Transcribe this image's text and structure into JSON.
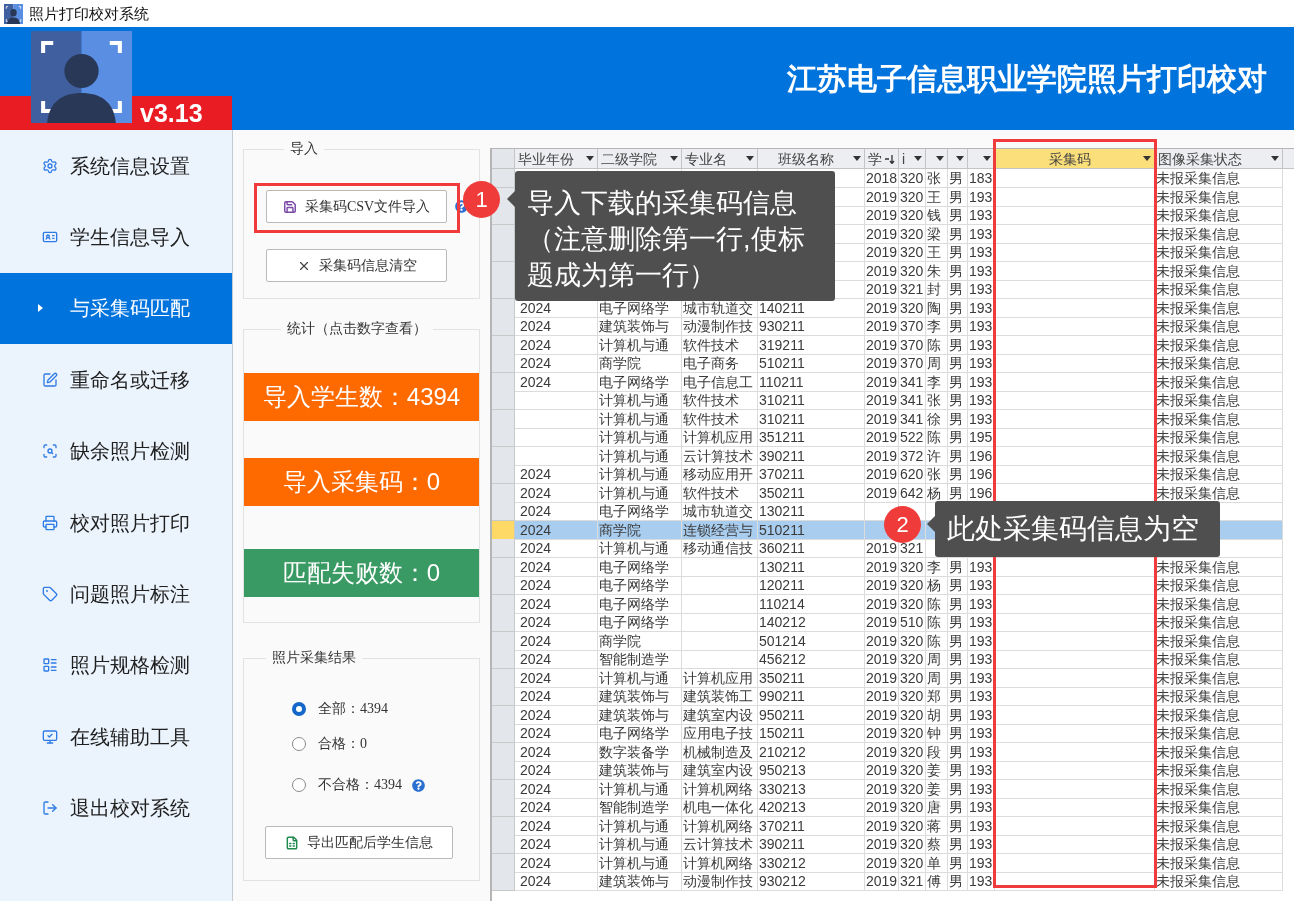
{
  "title_bar": {
    "title": "照片打印校对系统"
  },
  "header": {
    "version": "v3.13",
    "title": "江苏电子信息职业学院照片打印校对"
  },
  "sidebar": {
    "items": [
      {
        "label": "系统信息设置",
        "selected": false
      },
      {
        "label": "学生信息导入",
        "selected": false
      },
      {
        "label": "与采集码匹配",
        "selected": true
      },
      {
        "label": "重命名或迁移",
        "selected": false
      },
      {
        "label": "缺余照片检测",
        "selected": false
      },
      {
        "label": "校对照片打印",
        "selected": false
      },
      {
        "label": "问题照片标注",
        "selected": false
      },
      {
        "label": "照片规格检测",
        "selected": false
      },
      {
        "label": "在线辅助工具",
        "selected": false
      },
      {
        "label": "退出校对系统",
        "selected": false
      }
    ]
  },
  "import_group": {
    "legend": "导入",
    "buttons": [
      {
        "label": "采集码CSV文件导入",
        "help": true
      },
      {
        "label": "采集码信息清空",
        "help": false
      }
    ]
  },
  "stats_group": {
    "legend": "统计（点击数字查看）",
    "stats": [
      {
        "label": "导入学生数：4394",
        "color": "#ff6a00"
      },
      {
        "label": "导入采集码：0",
        "color": "#ff6a00"
      },
      {
        "label": "匹配失败数：0",
        "color": "#399a63"
      }
    ]
  },
  "result_group": {
    "legend": "照片采集结果",
    "options": [
      {
        "label": "全部：4394",
        "selected": true,
        "help": false
      },
      {
        "label": "合格：0",
        "selected": false,
        "help": false
      },
      {
        "label": "不合格：4394",
        "selected": false,
        "help": true
      }
    ],
    "export_button": "导出匹配后学生信息"
  },
  "table": {
    "columns": [
      {
        "label": "毕业年份",
        "selected": false,
        "sorted": false
      },
      {
        "label": "二级学院",
        "selected": false,
        "sorted": false
      },
      {
        "label": "专业名",
        "selected": false,
        "sorted": false
      },
      {
        "label": "班级名称",
        "selected": false,
        "sorted": false
      },
      {
        "label": "学",
        "selected": false,
        "sorted": true
      },
      {
        "label": "i",
        "selected": false,
        "sorted": false
      },
      {
        "selected": false,
        "sorted": false
      },
      {
        "selected": false,
        "sorted": false
      },
      {
        "selected": false,
        "sorted": false
      },
      {
        "label": "采集码",
        "selected": true,
        "sorted": false
      },
      {
        "label": "图像采集状态",
        "selected": false,
        "sorted": false
      }
    ],
    "rows": [
      {
        "selected": false,
        "column_5": "2018",
        "column_6": "320",
        "column_7": "张",
        "column_8": "男",
        "column_9": "183",
        "image_status": "未报采集信息"
      },
      {
        "selected": false,
        "column_5": "2019",
        "column_6": "320",
        "column_7": "王",
        "column_8": "男",
        "column_9": "193",
        "image_status": "未报采集信息"
      },
      {
        "selected": false,
        "column_5": "2019",
        "column_6": "320",
        "column_7": "钱",
        "column_8": "男",
        "column_9": "193",
        "image_status": "未报采集信息"
      },
      {
        "selected": false,
        "column_5": "2019",
        "column_6": "320",
        "column_7": "梁",
        "column_8": "男",
        "column_9": "193",
        "image_status": "未报采集信息"
      },
      {
        "selected": false,
        "column_5": "2019",
        "column_6": "320",
        "column_7": "王",
        "column_8": "男",
        "column_9": "193",
        "image_status": "未报采集信息"
      },
      {
        "selected": false,
        "column_5": "2019",
        "column_6": "320",
        "column_7": "朱",
        "column_8": "男",
        "column_9": "193",
        "image_status": "未报采集信息"
      },
      {
        "selected": false,
        "column_5": "2019",
        "column_6": "321",
        "column_7": "封",
        "column_8": "男",
        "column_9": "193",
        "image_status": "未报采集信息"
      },
      {
        "selected": false,
        "graduation_year": "2024",
        "college": "电子网络学",
        "column_3": "城市轨道交",
        "class_name": "140211",
        "column_5": "2019",
        "column_6": "320",
        "column_7": "陶",
        "column_8": "男",
        "column_9": "193",
        "image_status": "未报采集信息"
      },
      {
        "selected": false,
        "graduation_year": "2024",
        "college": "建筑装饰与",
        "column_3": "动漫制作技",
        "class_name": "930211",
        "column_5": "2019",
        "column_6": "370",
        "column_7": "李",
        "column_8": "男",
        "column_9": "193",
        "image_status": "未报采集信息"
      },
      {
        "selected": false,
        "graduation_year": "2024",
        "college": "计算机与通",
        "column_3": "软件技术",
        "class_name": "319211",
        "column_5": "2019",
        "column_6": "370",
        "column_7": "陈",
        "column_8": "男",
        "column_9": "193",
        "image_status": "未报采集信息"
      },
      {
        "selected": false,
        "graduation_year": "2024",
        "college": "商学院",
        "column_3": "电子商务",
        "class_name": "510211",
        "column_5": "2019",
        "column_6": "370",
        "column_7": "周",
        "column_8": "男",
        "column_9": "193",
        "image_status": "未报采集信息"
      },
      {
        "selected": false,
        "graduation_year": "2024",
        "college": "电子网络学",
        "column_3": "电子信息工",
        "class_name": "110211",
        "column_5": "2019",
        "column_6": "341",
        "column_7": "李",
        "column_8": "男",
        "column_9": "193",
        "image_status": "未报采集信息"
      },
      {
        "selected": false,
        "college": "计算机与通",
        "column_3": "软件技术",
        "class_name": "310211",
        "column_5": "2019",
        "column_6": "341",
        "column_7": "张",
        "column_8": "男",
        "column_9": "193",
        "image_status": "未报采集信息"
      },
      {
        "selected": false,
        "college": "计算机与通",
        "column_3": "软件技术",
        "class_name": "310211",
        "column_5": "2019",
        "column_6": "341",
        "column_7": "徐",
        "column_8": "男",
        "column_9": "193",
        "image_status": "未报采集信息"
      },
      {
        "selected": false,
        "college": "计算机与通",
        "column_3": "计算机应用",
        "class_name": "351211",
        "column_5": "2019",
        "column_6": "522",
        "column_7": "陈",
        "column_8": "男",
        "column_9": "195",
        "image_status": "未报采集信息"
      },
      {
        "selected": false,
        "college": "计算机与通",
        "column_3": "云计算技术",
        "class_name": "390211",
        "column_5": "2019",
        "column_6": "372",
        "column_7": "许",
        "column_8": "男",
        "column_9": "196",
        "image_status": "未报采集信息"
      },
      {
        "selected": false,
        "graduation_year": "2024",
        "college": "计算机与通",
        "column_3": "移动应用开",
        "class_name": "370211",
        "column_5": "2019",
        "column_6": "620",
        "column_7": "张",
        "column_8": "男",
        "column_9": "196",
        "image_status": "未报采集信息"
      },
      {
        "selected": false,
        "graduation_year": "2024",
        "college": "计算机与通",
        "column_3": "软件技术",
        "class_name": "350211",
        "column_5": "2019",
        "column_6": "642",
        "column_7": "杨",
        "column_8": "男",
        "column_9": "196",
        "image_status": "未报采集信息"
      },
      {
        "selected": false,
        "graduation_year": "2024",
        "college": "电子网络学",
        "column_3": "城市轨道交",
        "class_name": "130211"
      },
      {
        "selected": true,
        "graduation_year": "2024",
        "college": "商学院",
        "column_3": "连锁经营与",
        "class_name": "510211"
      },
      {
        "selected": false,
        "graduation_year": "2024",
        "college": "计算机与通",
        "column_3": "移动通信技",
        "class_name": "360211",
        "column_5": "2019",
        "column_6": "321"
      },
      {
        "selected": false,
        "graduation_year": "2024",
        "college": "电子网络学",
        "class_name": "130211",
        "column_5": "2019",
        "column_6": "320",
        "column_7": "李",
        "column_8": "男",
        "column_9": "193",
        "image_status": "未报采集信息"
      },
      {
        "selected": false,
        "graduation_year": "2024",
        "college": "电子网络学",
        "class_name": "120211",
        "column_5": "2019",
        "column_6": "320",
        "column_7": "杨",
        "column_8": "男",
        "column_9": "193",
        "image_status": "未报采集信息"
      },
      {
        "selected": false,
        "graduation_year": "2024",
        "college": "电子网络学",
        "class_name": "110214",
        "column_5": "2019",
        "column_6": "320",
        "column_7": "陈",
        "column_8": "男",
        "column_9": "193",
        "image_status": "未报采集信息"
      },
      {
        "selected": false,
        "graduation_year": "2024",
        "college": "电子网络学",
        "class_name": "140212",
        "column_5": "2019",
        "column_6": "510",
        "column_7": "陈",
        "column_8": "男",
        "column_9": "193",
        "image_status": "未报采集信息"
      },
      {
        "selected": false,
        "graduation_year": "2024",
        "college": "商学院",
        "class_name": "501214",
        "column_5": "2019",
        "column_6": "320",
        "column_7": "陈",
        "column_8": "男",
        "column_9": "193",
        "image_status": "未报采集信息"
      },
      {
        "selected": false,
        "graduation_year": "2024",
        "college": "智能制造学",
        "class_name": "456212",
        "column_5": "2019",
        "column_6": "320",
        "column_7": "周",
        "column_8": "男",
        "column_9": "193",
        "image_status": "未报采集信息"
      },
      {
        "selected": false,
        "graduation_year": "2024",
        "college": "计算机与通",
        "column_3": "计算机应用",
        "class_name": "350211",
        "column_5": "2019",
        "column_6": "320",
        "column_7": "周",
        "column_8": "男",
        "column_9": "193",
        "image_status": "未报采集信息"
      },
      {
        "selected": false,
        "graduation_year": "2024",
        "college": "建筑装饰与",
        "column_3": "建筑装饰工",
        "class_name": "990211",
        "column_5": "2019",
        "column_6": "320",
        "column_7": "郑",
        "column_8": "男",
        "column_9": "193",
        "image_status": "未报采集信息"
      },
      {
        "selected": false,
        "graduation_year": "2024",
        "college": "建筑装饰与",
        "column_3": "建筑室内设",
        "class_name": "950211",
        "column_5": "2019",
        "column_6": "320",
        "column_7": "胡",
        "column_8": "男",
        "column_9": "193",
        "image_status": "未报采集信息"
      },
      {
        "selected": false,
        "graduation_year": "2024",
        "college": "电子网络学",
        "column_3": "应用电子技",
        "class_name": "150211",
        "column_5": "2019",
        "column_6": "320",
        "column_7": "钟",
        "column_8": "男",
        "column_9": "193",
        "image_status": "未报采集信息"
      },
      {
        "selected": false,
        "graduation_year": "2024",
        "college": "数字装备学",
        "column_3": "机械制造及",
        "class_name": "210212",
        "column_5": "2019",
        "column_6": "320",
        "column_7": "段",
        "column_8": "男",
        "column_9": "193",
        "image_status": "未报采集信息"
      },
      {
        "selected": false,
        "graduation_year": "2024",
        "college": "建筑装饰与",
        "column_3": "建筑室内设",
        "class_name": "950213",
        "column_5": "2019",
        "column_6": "320",
        "column_7": "姜",
        "column_8": "男",
        "column_9": "193",
        "image_status": "未报采集信息"
      },
      {
        "selected": false,
        "graduation_year": "2024",
        "college": "计算机与通",
        "column_3": "计算机网络",
        "class_name": "330213",
        "column_5": "2019",
        "column_6": "320",
        "column_7": "姜",
        "column_8": "男",
        "column_9": "193",
        "image_status": "未报采集信息"
      },
      {
        "selected": false,
        "graduation_year": "2024",
        "college": "智能制造学",
        "column_3": "机电一体化",
        "class_name": "420213",
        "column_5": "2019",
        "column_6": "320",
        "column_7": "唐",
        "column_8": "男",
        "column_9": "193",
        "image_status": "未报采集信息"
      },
      {
        "selected": false,
        "graduation_year": "2024",
        "college": "计算机与通",
        "column_3": "计算机网络",
        "class_name": "370211",
        "column_5": "2019",
        "column_6": "320",
        "column_7": "蒋",
        "column_8": "男",
        "column_9": "193",
        "image_status": "未报采集信息"
      },
      {
        "selected": false,
        "graduation_year": "2024",
        "college": "计算机与通",
        "column_3": "云计算技术",
        "class_name": "390211",
        "column_5": "2019",
        "column_6": "320",
        "column_7": "蔡",
        "column_8": "男",
        "column_9": "193",
        "image_status": "未报采集信息"
      },
      {
        "selected": false,
        "graduation_year": "2024",
        "college": "计算机与通",
        "column_3": "计算机网络",
        "class_name": "330212",
        "column_5": "2019",
        "column_6": "320",
        "column_7": "单",
        "column_8": "男",
        "column_9": "193",
        "image_status": "未报采集信息"
      },
      {
        "selected": false,
        "graduation_year": "2024",
        "college": "建筑装饰与",
        "column_3": "动漫制作技",
        "class_name": "930212",
        "column_5": "2019",
        "column_6": "321",
        "column_7": "傅",
        "column_8": "男",
        "column_9": "193",
        "image_status": "未报采集信息"
      }
    ]
  },
  "annotations": [
    {
      "number": "1",
      "lines": [
        "导入下载的采集码信息",
        "（注意删除第一行,使标题成为第一行）"
      ]
    },
    {
      "number": "2",
      "lines": [
        "此处采集码信息为空"
      ]
    }
  ]
}
